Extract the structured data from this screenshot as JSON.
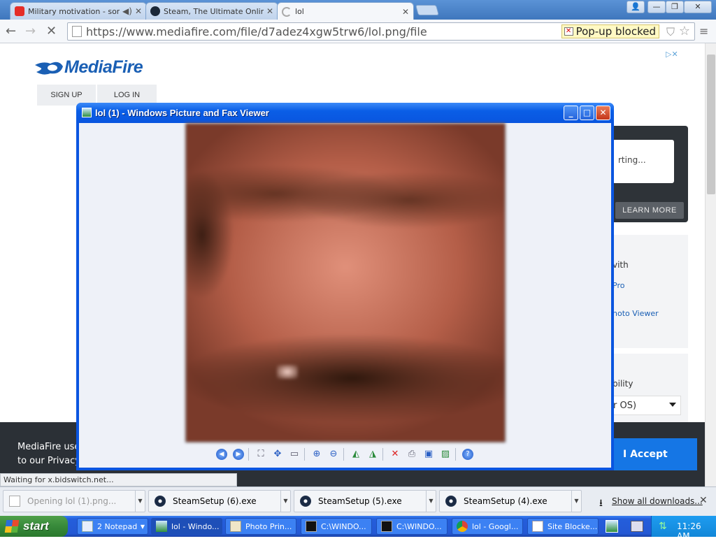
{
  "browser": {
    "tabs": [
      {
        "title": "Military motivation - song",
        "favicon": "youtube-icon",
        "favicon_color": "#e52d27"
      },
      {
        "title": "Steam, The Ultimate Online G",
        "favicon": "steam-icon",
        "favicon_color": "#1b2838"
      },
      {
        "title": "lol",
        "favicon": "loading-spinner-icon",
        "favicon_color": "#999999"
      }
    ],
    "url": "https://www.mediafire.com/file/d7adez4xgw5trw6/lol.png/file",
    "popup_blocked": "Pop-up blocked"
  },
  "site": {
    "logo_text": "MediaFire",
    "brand_color": "#1a5fb4",
    "signup": "SIGN UP",
    "login": "LOG IN",
    "right_partial_1": "rting...",
    "learn_more": "LEARN MORE",
    "right_partial_2": "vith",
    "right_link_1": "Pro",
    "right_link_2": "hoto Viewer",
    "right_partial_3": "bility",
    "os_select": "r OS)",
    "cookie_text_1": "MediaFire uses",
    "cookie_text_2": "to our Privacy P",
    "accept": "I Accept"
  },
  "viewer": {
    "title": "lol (1) - Windows Picture and Fax Viewer"
  },
  "status": "Waiting for x.bidswitch.net...",
  "downloads": {
    "items": [
      {
        "name": "Opening lol (1).png...",
        "icon": "file-icon",
        "muted": true
      },
      {
        "name": "SteamSetup (6).exe",
        "icon": "steam-icon"
      },
      {
        "name": "SteamSetup (5).exe",
        "icon": "steam-icon"
      },
      {
        "name": "SteamSetup (4).exe",
        "icon": "steam-icon"
      }
    ],
    "show_all": "Show all downloads..."
  },
  "taskbar": {
    "start": "start",
    "items": [
      {
        "label": "2 Notepad",
        "icon": "notepad-icon"
      },
      {
        "label": "lol - Windo...",
        "icon": "picture-viewer-icon"
      },
      {
        "label": "Photo Prin...",
        "icon": "photo-printing-icon"
      },
      {
        "label": "C:\\WINDO...",
        "icon": "cmd-icon"
      },
      {
        "label": "C:\\WINDO...",
        "icon": "cmd-icon"
      },
      {
        "label": "lol - Googl...",
        "icon": "chrome-icon"
      },
      {
        "label": "Site Blocke...",
        "icon": "document-icon"
      }
    ],
    "clock": "11:26 AM"
  }
}
